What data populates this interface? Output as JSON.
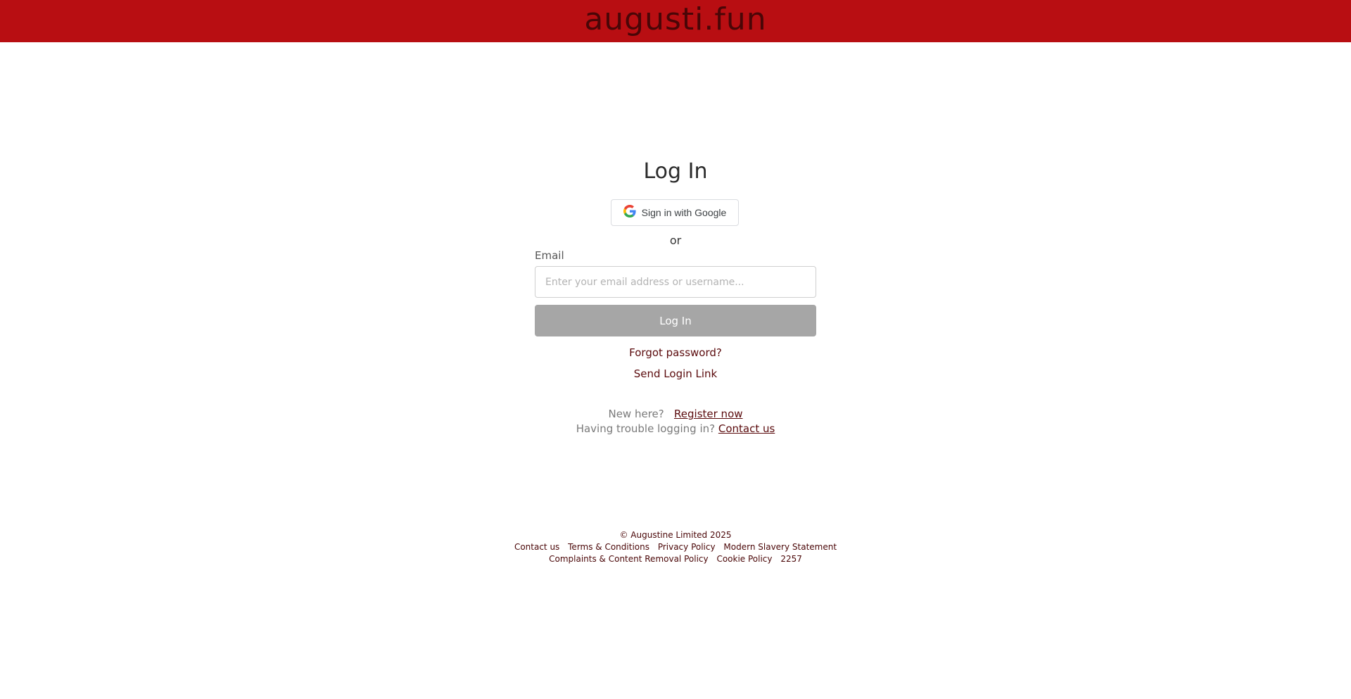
{
  "header": {
    "brand": "augusti.fun",
    "bg_color": "#b80e12"
  },
  "login": {
    "title": "Log In",
    "google_button_label": "Sign in with Google",
    "google_icon": "google-g-icon",
    "separator": "or",
    "email_label": "Email",
    "email_placeholder": "Enter your email address or username...",
    "email_value": "",
    "submit_label": "Log In",
    "forgot_password": "Forgot password?",
    "send_login_link": "Send Login Link",
    "new_here_text": "New here?",
    "register_link": "Register now",
    "trouble_text": "Having trouble logging in?",
    "contact_link": "Contact us"
  },
  "footer": {
    "copyright": "© Augustine Limited  2025",
    "links_row1": [
      "Contact us",
      "Terms & Conditions",
      "Privacy Policy",
      "Modern Slavery Statement"
    ],
    "links_row2": [
      "Complaints & Content Removal Policy",
      "Cookie Policy",
      "2257"
    ]
  },
  "colors": {
    "accent": "#b80e12",
    "link": "#5a0a0c",
    "button_disabled": "#a6a6a6"
  }
}
